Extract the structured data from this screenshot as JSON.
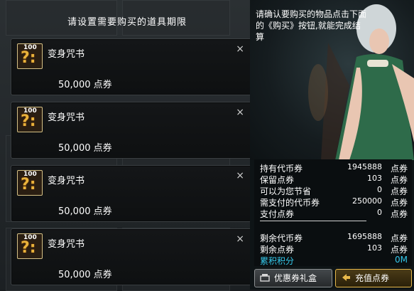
{
  "left_panel": {
    "title": "请设置需要购买的道具期限",
    "items": [
      {
        "name": "变身咒书",
        "price": "50,000 点券",
        "level_badge": "100",
        "close": "×"
      },
      {
        "name": "变身咒书",
        "price": "50,000 点券",
        "level_badge": "100",
        "close": "×"
      },
      {
        "name": "变身咒书",
        "price": "50,000 点券",
        "level_badge": "100",
        "close": "×"
      },
      {
        "name": "变身咒书",
        "price": "50,000 点券",
        "level_badge": "100",
        "close": "×"
      }
    ]
  },
  "right_panel": {
    "message": "请确认要购买的物品点击下面的《购买》按钮,就能完成结算",
    "summary": [
      {
        "label": "持有代币券",
        "value": "1945888",
        "unit": "点券"
      },
      {
        "label": "保留点券",
        "value": "103",
        "unit": "点券"
      },
      {
        "label": "可以为您节省",
        "value": "0",
        "unit": "点券"
      },
      {
        "label": "需支付的代币券",
        "value": "250000",
        "unit": "点券"
      },
      {
        "label": "支付点券",
        "value": "0",
        "unit": "点券"
      },
      {
        "label": "剩余代币券",
        "value": "1695888",
        "unit": "点券"
      },
      {
        "label": "剩余点券",
        "value": "103",
        "unit": "点券"
      }
    ],
    "points": {
      "label": "累积积分",
      "value": "0M"
    },
    "buttons": {
      "coupon": "优惠券礼盒",
      "recharge": "充值点券"
    }
  },
  "icons": [
    "close-icon",
    "coupon-gift-icon",
    "recharge-icon"
  ],
  "colors": {
    "accent_text": "#35c9ec",
    "recharge_border": "#e7b84a"
  }
}
